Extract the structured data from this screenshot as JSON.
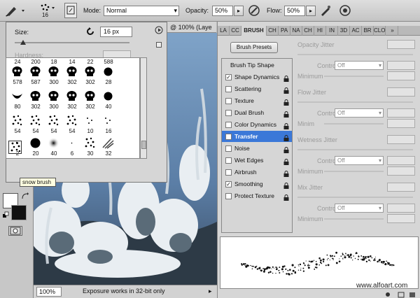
{
  "options_bar": {
    "brush_size": "16",
    "mode_label": "Mode:",
    "mode_value": "Normal",
    "opacity_label": "Opacity:",
    "opacity_value": "50%",
    "flow_label": "Flow:",
    "flow_value": "50%"
  },
  "brush_picker": {
    "size_label": "Size:",
    "size_value": "16 px",
    "hardness_label": "Hardness:",
    "top_numbers": [
      "24",
      "200",
      "18",
      "14",
      "22",
      "588"
    ],
    "rows": [
      [
        "578",
        "587",
        "300",
        "302",
        "302",
        "28"
      ],
      [
        "80",
        "302",
        "300",
        "302",
        "302",
        "40"
      ],
      [
        "54",
        "54",
        "54",
        "54",
        "10",
        "16"
      ],
      [
        "2",
        "20",
        "40",
        "6",
        "30",
        "32"
      ]
    ],
    "tooltip": "snow brush"
  },
  "document": {
    "tab_title": "@ 100% (Laye",
    "zoom": "100%",
    "status": "Exposure works in 32-bit only"
  },
  "brush_panel": {
    "tabs": [
      "LA",
      "CC",
      "BRUSH",
      "CH",
      "PA",
      "NA",
      "CH",
      "HI",
      "IN",
      "3D",
      "AC",
      "BR",
      "CLO"
    ],
    "presets_button": "Brush Presets",
    "tip_shape": "Brush Tip Shape",
    "options": [
      {
        "label": "Shape Dynamics",
        "checked": true
      },
      {
        "label": "Scattering",
        "checked": false
      },
      {
        "label": "Texture",
        "checked": false
      },
      {
        "label": "Dual Brush",
        "checked": false
      },
      {
        "label": "Color Dynamics",
        "checked": false
      },
      {
        "label": "Transfer",
        "checked": false
      },
      {
        "label": "Noise",
        "checked": false
      },
      {
        "label": "Wet Edges",
        "checked": false
      },
      {
        "label": "Airbrush",
        "checked": false
      },
      {
        "label": "Smoothing",
        "checked": true
      },
      {
        "label": "Protect Texture",
        "checked": false
      }
    ],
    "right": {
      "opacity_jitter": "Opacity Jitter",
      "flow_jitter": "Flow Jitter",
      "wetness_jitter": "Wetness Jitter",
      "mix_jitter": "Mix Jitter",
      "control_label": "Control:",
      "control_value": "Off",
      "minimum_label": "Minimum",
      "minimum_short": "Minim"
    }
  },
  "watermark": "www.alfoart.com"
}
